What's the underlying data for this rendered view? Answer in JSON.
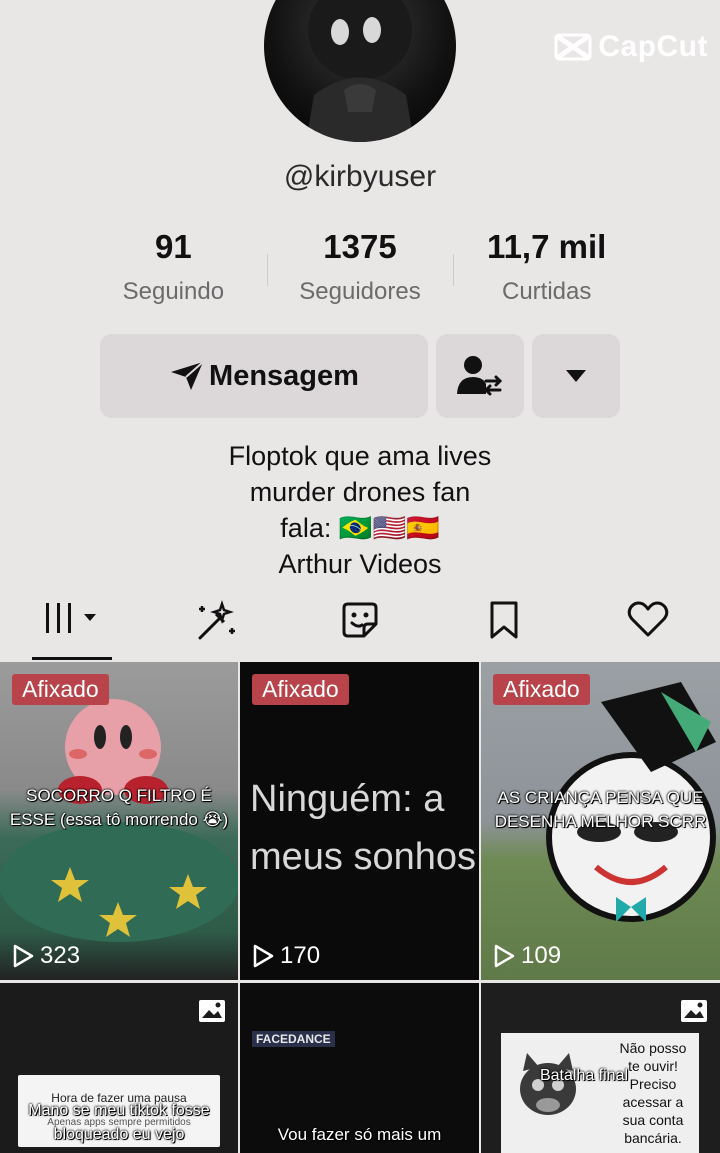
{
  "watermark": {
    "brand": "CapCut"
  },
  "profile": {
    "username": "@kirbyuser",
    "stats": [
      {
        "value": "91",
        "label": "Seguindo"
      },
      {
        "value": "1375",
        "label": "Seguidores"
      },
      {
        "value": "11,7 mil",
        "label": "Curtidas"
      }
    ],
    "message_button": "Mensagem",
    "bio": [
      "Floptok que ama lives",
      "murder drones fan",
      "fala: 🇧🇷🇺🇸🇪🇸",
      "Arthur Videos"
    ]
  },
  "tabs": [
    {
      "icon": "grid-icon",
      "active": true
    },
    {
      "icon": "sparkle-wand-icon"
    },
    {
      "icon": "sticker-face-icon"
    },
    {
      "icon": "bookmark-icon"
    },
    {
      "icon": "heart-icon"
    }
  ],
  "videos": [
    {
      "pinned": "Afixado",
      "caption": "SOCORRO Q FILTRO É ESSE (essa tô morrendo 😭)",
      "views": "323"
    },
    {
      "pinned": "Afixado",
      "caption": "Ninguém: a meus sonhos",
      "views": "170"
    },
    {
      "pinned": "Afixado",
      "caption": "AS CRIANÇA PENSA QUE DESENHA MELHOR SCRR",
      "views": "109"
    },
    {
      "caption": "Mano se meu tiktok fosse bloqueado eu vejo",
      "overlay": "Hora de fazer uma pausa",
      "overlay_sub": "Apenas apps sempre permitidos"
    },
    {
      "logo": "FACEDANCE",
      "caption": "Vou fazer só mais um"
    },
    {
      "caption": "Batalha final",
      "side_text": "Não posso te ouvir! Preciso acessar a sua conta bancária."
    }
  ],
  "colors": {
    "pinned_badge": "#b8434a",
    "background": "#e9e6e6"
  }
}
